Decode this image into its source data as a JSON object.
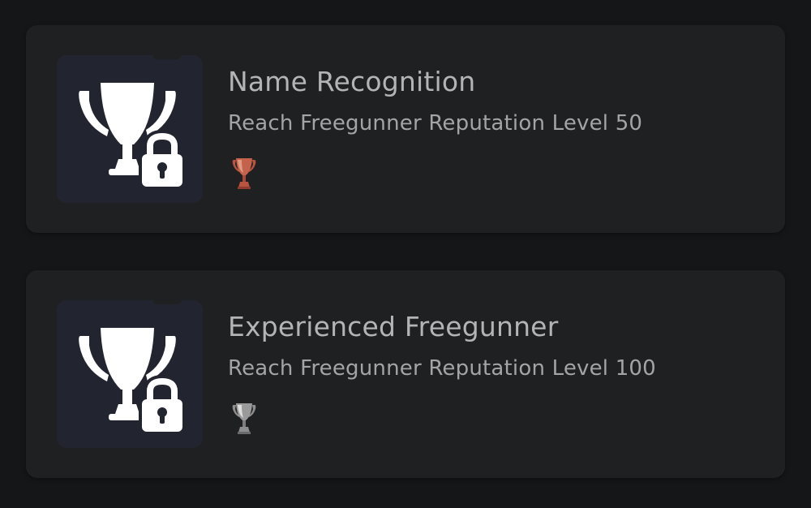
{
  "trophies": [
    {
      "title": "Name Recognition",
      "description": "Reach Freegunner Reputation Level 50",
      "grade": "bronze",
      "grade_color": "#b8543f",
      "locked": true
    },
    {
      "title": "Experienced Freegunner",
      "description": "Reach Freegunner Reputation Level 100",
      "grade": "silver",
      "grade_color": "#9a9a9a",
      "locked": true
    }
  ],
  "colors": {
    "background": "#151618",
    "card": "#1f2022",
    "tile": "#22252f",
    "title_text": "#b3b4b6",
    "description_text": "#a3a4a6"
  },
  "icons": {
    "locked_trophy": "trophy-icon",
    "lock": "lock-icon"
  }
}
